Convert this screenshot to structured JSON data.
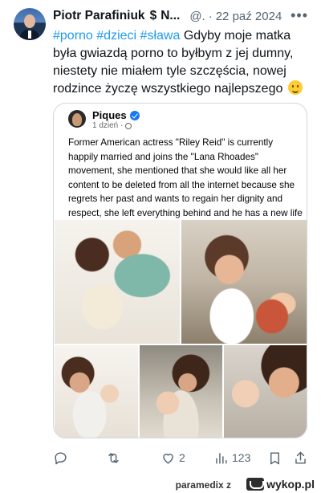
{
  "tweet": {
    "author_name": "Piotr Parafiniuk",
    "author_name_icon": "$",
    "author_name_trunc": "N...",
    "handle": "@.",
    "separator": "·",
    "date": "22 paź 2024",
    "more_icon": "more-icon",
    "hashtags": [
      "#porno",
      "#dzieci",
      "#sława"
    ],
    "text": "Gdyby moje matka była gwiazdą porno to byłbym z jej dumny, niestety nie miałem tyle szczęścia, nowej rodzince życzę wszystkiego najlepszego",
    "emoji": "slightly-smiling-face"
  },
  "embedded_post": {
    "author": "Piques",
    "verified": true,
    "meta": "1 dzień ·",
    "text": "Former American actress \"Riley Reid\" is currently happily married and joins the \"Lana Rhoades\" movement, she mentioned that she would like all her content to be deleted from all the internet because she regrets her past and wants to regain her dignity and respect, she left everything behind and he has a new life",
    "text_suffix": "!!",
    "photos": [
      "photo-1",
      "photo-2",
      "photo-3",
      "photo-4",
      "photo-5"
    ]
  },
  "actions": {
    "reply_count": "",
    "retweet_count": "",
    "like_count": "2",
    "views_count": "123"
  },
  "footer": {
    "source_user": "paramedix",
    "source_suffix": "z",
    "brand": "wykop.pl"
  },
  "colors": {
    "accent": "#1d9bf0",
    "muted": "#536471",
    "text": "#0f1419",
    "border": "#cfd9de",
    "verified": "#1877f2"
  }
}
